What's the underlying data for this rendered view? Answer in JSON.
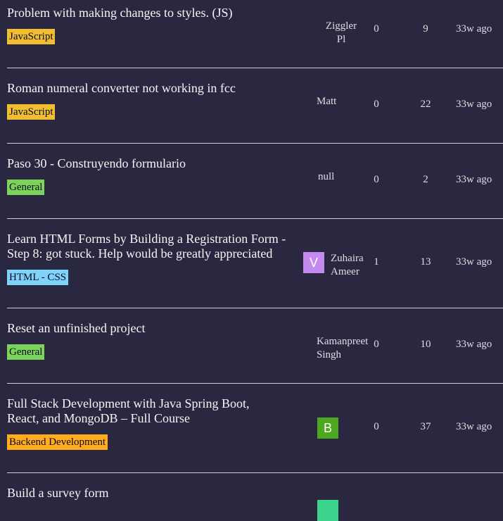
{
  "topics": [
    {
      "title": "Problem with making changes to styles. (JS)",
      "tag": "JavaScript",
      "tag_color": "#f1be32",
      "user": "Ziggler\nPl",
      "replies": "0",
      "views": "9",
      "activity": "33w ago"
    },
    {
      "title": "Roman numeral converter not working in fcc",
      "tag": "JavaScript",
      "tag_color": "#f1be32",
      "user": "Matt",
      "replies": "0",
      "views": "22",
      "activity": "33w ago"
    },
    {
      "title": "Paso 30 - Construyendo formulario",
      "tag": "General",
      "tag_color": "#7cd35a",
      "user": "null",
      "replies": "0",
      "views": "2",
      "activity": "33w ago"
    },
    {
      "title": "Learn HTML Forms by Building a Registration Form - Step 8: got stuck. Help would be greatly appreciated",
      "tag": "HTML - CSS",
      "tag_color": "#7fd3fb",
      "avatar_letter": "V",
      "avatar_color": "#c58af0",
      "user": "Zuhaira\nAmeer",
      "replies": "1",
      "views": "13",
      "activity": "33w ago"
    },
    {
      "title": "Reset an unfinished project",
      "tag": "General",
      "tag_color": "#7cd35a",
      "user": "Kamanpreet\nSingh",
      "replies": "0",
      "views": "10",
      "activity": "33w ago"
    },
    {
      "title": "Full Stack Development with Java Spring Boot, React, and MongoDB – Full Course",
      "tag": "Backend Development",
      "tag_color": "#ffad1f",
      "avatar_letter": "B",
      "avatar_color": "#4ca91f",
      "replies": "0",
      "views": "37",
      "activity": "33w ago"
    },
    {
      "title": "Build a survey form",
      "avatar_color": "#3cd38d"
    }
  ]
}
